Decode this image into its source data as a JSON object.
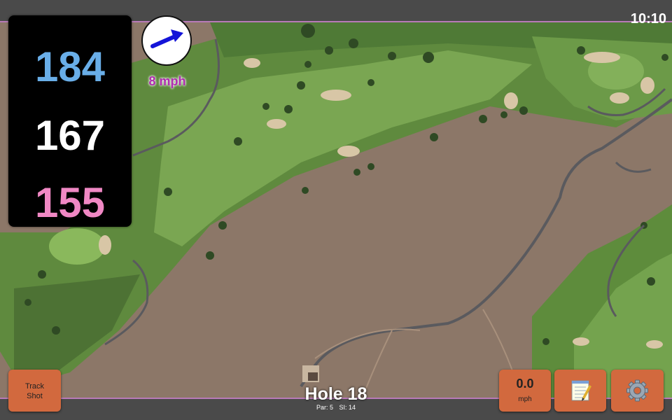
{
  "status": {
    "time": "10:10"
  },
  "yardages": {
    "back": "184",
    "middle": "167",
    "front": "155"
  },
  "wind": {
    "label": "8 mph",
    "icon": "wind-arrow-icon"
  },
  "buttons": {
    "track_shot": "Track\nShot",
    "speed_value": "0.0",
    "speed_unit": "mph",
    "notes_icon": "notepad-icon",
    "settings_icon": "gear-icon"
  },
  "hole": {
    "title": "Hole 18",
    "par": "Par: 5",
    "si": "SI: 14"
  },
  "colors": {
    "accent": "#d2693e",
    "back_yardage": "#69aee8",
    "front_yardage": "#f088c4",
    "wind_text": "#b02cb0",
    "map_border": "#b87ab8"
  }
}
